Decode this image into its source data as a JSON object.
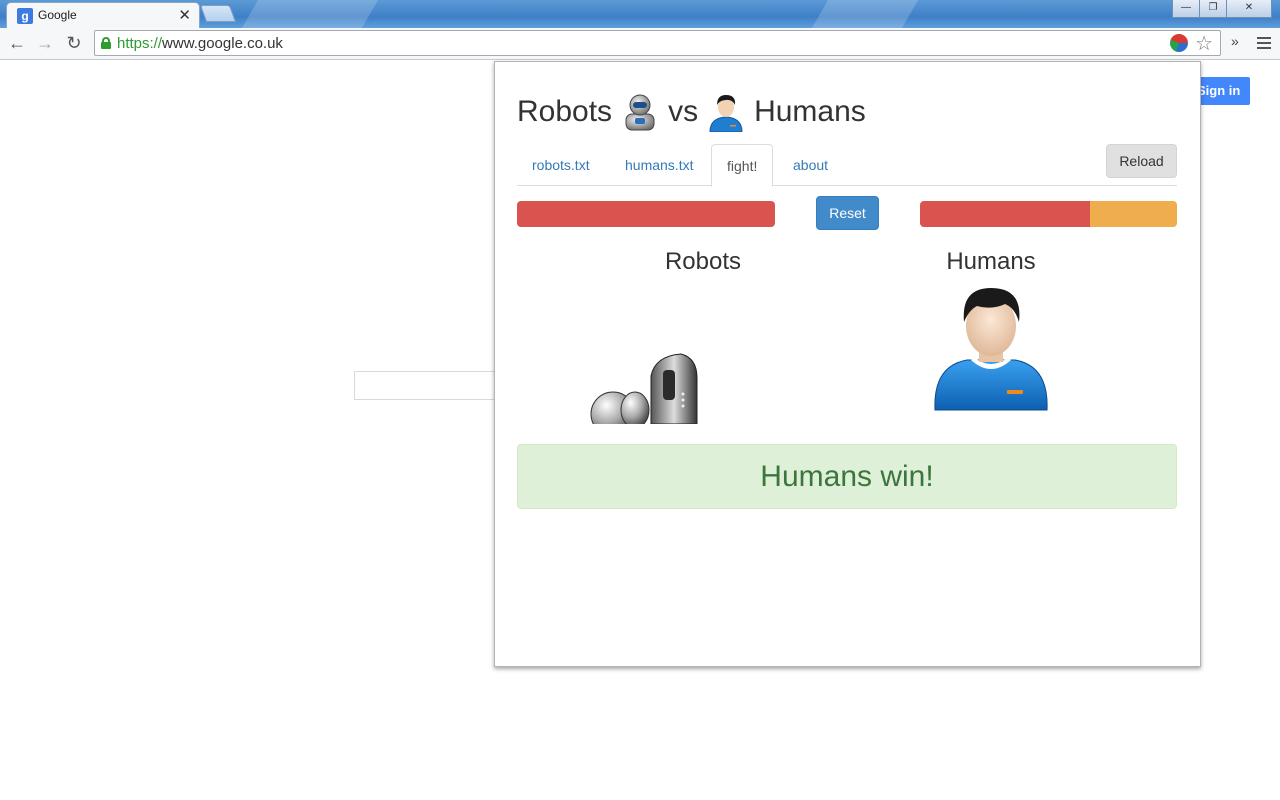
{
  "browser": {
    "tab_title": "Google",
    "tab_favicon": "g",
    "tab_close": "✕",
    "url_scheme": "https://",
    "url_rest": "www.google.co.uk",
    "win_minimize": "—",
    "win_maximize": "❐",
    "win_close": "✕",
    "more_extensions": "»"
  },
  "page": {
    "signin_label": "Sign in"
  },
  "popup": {
    "title_left": "Robots",
    "title_vs": "vs",
    "title_right": "Humans",
    "tabs": [
      {
        "label": "robots.txt"
      },
      {
        "label": "humans.txt"
      },
      {
        "label": "fight!"
      },
      {
        "label": "about"
      }
    ],
    "reload_label": "Reload",
    "reset_label": "Reset",
    "robots_health": {
      "remaining_fraction": 0,
      "damage_fraction": 1
    },
    "humans_health": {
      "remaining_fraction": 0.34,
      "damage_fraction": 0.66
    },
    "robots_name": "Robots",
    "humans_name": "Humans",
    "result_text": "Humans win!"
  },
  "colors": {
    "danger": "#d9534f",
    "warning": "#f0ad4e",
    "primary": "#428bca",
    "success_bg": "#dff0d8",
    "success_text": "#3c763d"
  }
}
